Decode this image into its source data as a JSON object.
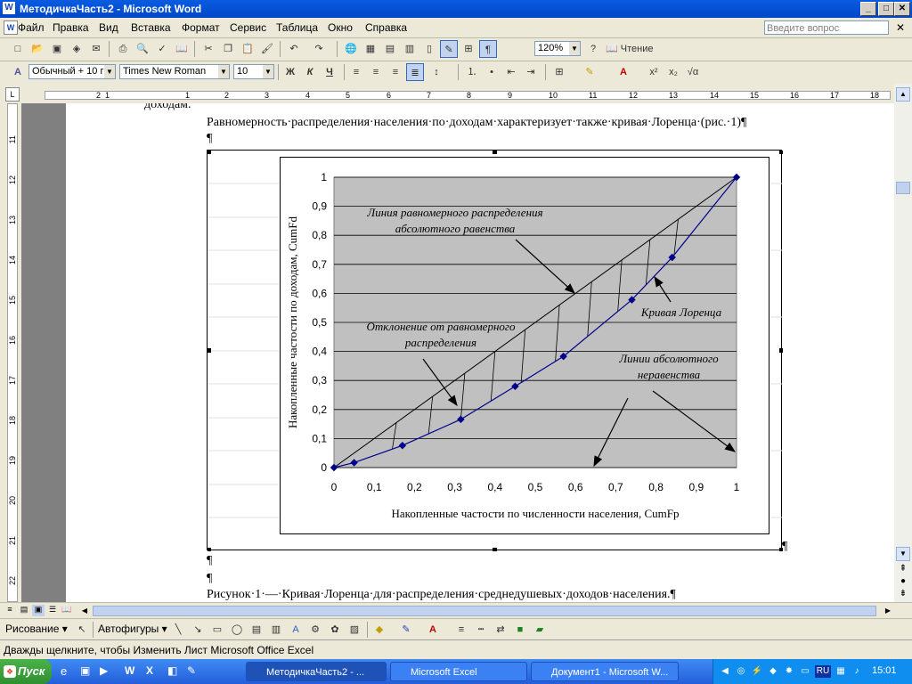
{
  "window": {
    "title": "МетодичкаЧасть2 - Microsoft Word"
  },
  "menubar": {
    "items": [
      "Файл",
      "Правка",
      "Вид",
      "Вставка",
      "Формат",
      "Сервис",
      "Таблица",
      "Окно",
      "Справка"
    ],
    "help_placeholder": "Введите вопрос"
  },
  "standard_toolbar": {
    "zoom": "120%",
    "reading_label": "Чтение"
  },
  "format_toolbar": {
    "style": "Обычный + 10 г",
    "font": "Times New Roman",
    "size": "10",
    "bold": "Ж",
    "italic": "К",
    "underline": "Ч"
  },
  "ruler": {
    "h_ticks": [
      "2",
      "1",
      "1",
      "2",
      "3",
      "4",
      "5",
      "6",
      "7",
      "8",
      "9",
      "10",
      "11",
      "12",
      "13",
      "14",
      "15",
      "16",
      "17",
      "18"
    ],
    "v_ticks": [
      "11",
      "12",
      "13",
      "14",
      "15",
      "16",
      "17",
      "18",
      "19",
      "20",
      "21",
      "22"
    ]
  },
  "document": {
    "cut_line": "доходам.",
    "para1": "Равномерность·распределения·населения·по·доходам·характеризует·также·кривая·Лоренца·(рис.·1)¶",
    "mark": "¶",
    "caption": "Рисунок·1·—·Кривая·Лоренца·для·распределения·среднедушевых·доходов·населения.¶"
  },
  "chart_data": {
    "type": "line",
    "xlabel": "Накопленные частости по численности населения, CumFp",
    "ylabel": "Накопленные частости по доходам, CumFd",
    "xlim": [
      0,
      1
    ],
    "ylim": [
      0,
      1
    ],
    "x_ticks": [
      "0",
      "0,1",
      "0,2",
      "0,3",
      "0,4",
      "0,5",
      "0,6",
      "0,7",
      "0,8",
      "0,9",
      "1"
    ],
    "y_ticks": [
      "0",
      "0,1",
      "0,2",
      "0,3",
      "0,4",
      "0,5",
      "0,6",
      "0,7",
      "0,8",
      "0,9",
      "1"
    ],
    "grid": true,
    "series": [
      {
        "values": [
          [
            0,
            0
          ],
          [
            1,
            1
          ]
        ]
      },
      {
        "values": [
          [
            0,
            0
          ],
          [
            0.05,
            0.017
          ],
          [
            0.17,
            0.076
          ],
          [
            0.315,
            0.166
          ],
          [
            0.45,
            0.28
          ],
          [
            0.57,
            0.383
          ],
          [
            0.74,
            0.578
          ],
          [
            0.84,
            0.724
          ],
          [
            1,
            1
          ]
        ]
      }
    ],
    "deviation_lines_x": [
      0.155,
      0.245,
      0.325,
      0.4,
      0.475,
      0.56,
      0.64,
      0.715,
      0.785,
      0.855
    ],
    "annotations": [
      {
        "lines": [
          "Линия равномерного распределения",
          "абсолютного равенства"
        ]
      },
      {
        "lines": [
          "Отклонение от равномерного",
          "распределения"
        ]
      },
      {
        "lines": [
          "Кривая Лоренца"
        ]
      },
      {
        "lines": [
          "Линии абсолютного",
          "неравенства"
        ]
      }
    ]
  },
  "drawing_toolbar": {
    "draw_label": "Рисование",
    "autoshapes_label": "Автофигуры"
  },
  "status": {
    "text": "Дважды щелкните, чтобы Изменить Лист Microsoft Office Excel"
  },
  "taskbar": {
    "start": "Пуск",
    "tasks": [
      "МетодичкаЧасть2 - ...",
      "Microsoft Excel",
      "Документ1 - Microsoft W..."
    ],
    "lang": "RU",
    "time": "15:01"
  },
  "colors": {
    "title_bar": "#0a5ce0",
    "plot_area": "#c0c0c0",
    "curve": "#00008b",
    "taskbar": "#245edb"
  }
}
